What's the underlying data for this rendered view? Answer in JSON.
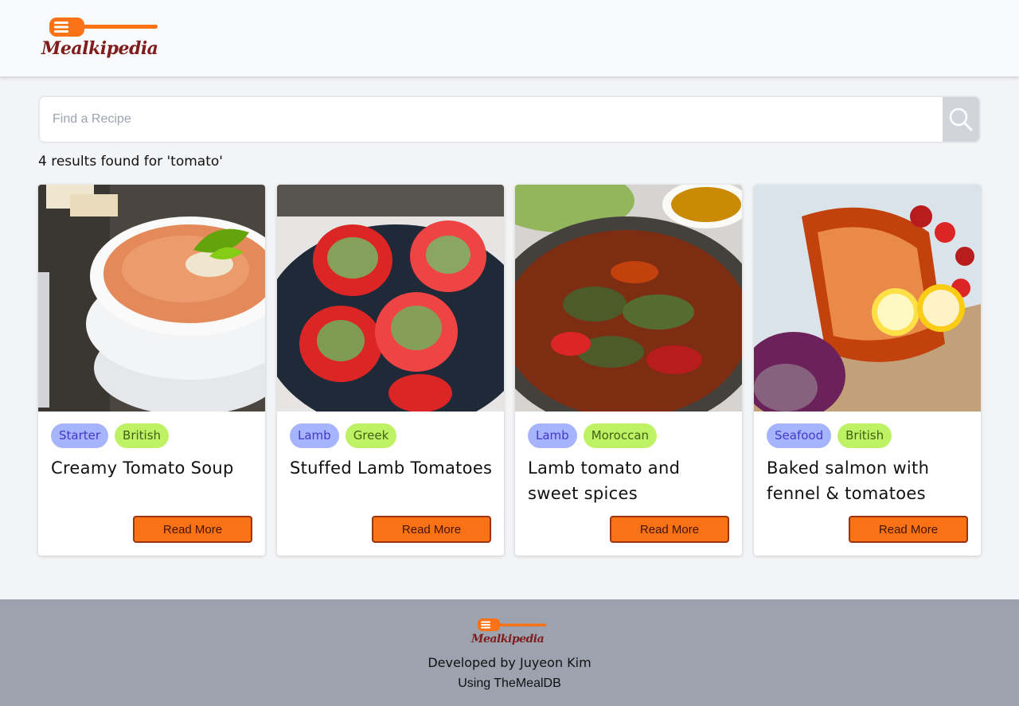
{
  "app": {
    "logo_text": "Mealkipedia",
    "brand_orange": "#f97316",
    "brand_dark_red": "#7f1d1d"
  },
  "search": {
    "placeholder": "Find a Recipe",
    "value": "",
    "icon": "search-icon"
  },
  "results": {
    "summary": "4 results found for 'tomato'"
  },
  "cards": [
    {
      "title": "Creamy Tomato Soup",
      "category": "Starter",
      "area": "British",
      "button_label": "Read More",
      "image": "tomato soup photo"
    },
    {
      "title": "Stuffed Lamb Tomatoes",
      "category": "Lamb",
      "area": "Greek",
      "button_label": "Read More",
      "image": "stuffed tomatoes photo"
    },
    {
      "title": "Lamb tomato and sweet spices",
      "category": "Lamb",
      "area": "Moroccan",
      "button_label": "Read More",
      "image": "lamb dolma pan photo"
    },
    {
      "title": "Baked salmon with fennel & tomatoes",
      "category": "Seafood",
      "area": "British",
      "button_label": "Read More",
      "image": "baked salmon photo"
    }
  ],
  "footer": {
    "logo_text": "Mealkipedia",
    "developer": "Developed by Juyeon Kim",
    "using": "Using TheMealDB"
  }
}
